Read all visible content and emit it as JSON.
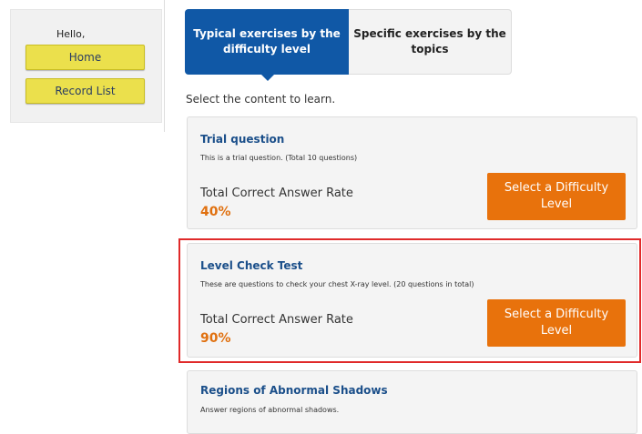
{
  "sidebar": {
    "greeting": "Hello,",
    "home_label": "Home",
    "record_list_label": "Record List"
  },
  "tabs": [
    {
      "label": "Typical exercises by the difficulty level",
      "active": true
    },
    {
      "label": "Specific exercises by the topics",
      "active": false
    }
  ],
  "instruction": "Select the content to learn.",
  "cards": [
    {
      "title": "Trial question",
      "description": "This is a trial question. (Total 10 questions)",
      "rate_label": "Total Correct Answer Rate",
      "rate_value": "40%",
      "button_label": "Select a Difficulty Level"
    },
    {
      "title": "Level Check Test",
      "description": "These are questions to check your chest X-ray level. (20 questions in total)",
      "rate_label": "Total Correct Answer Rate",
      "rate_value": "90%",
      "button_label": "Select a Difficulty Level",
      "highlighted": true
    },
    {
      "title": "Regions of Abnormal Shadows",
      "description": "Answer regions of abnormal shadows."
    }
  ],
  "colors": {
    "tab_active": "#1058a6",
    "accent_orange": "#e8720c",
    "sidebar_button": "#ebe04c",
    "highlight_border": "#e02a2a",
    "title_blue": "#1b4f8a"
  }
}
